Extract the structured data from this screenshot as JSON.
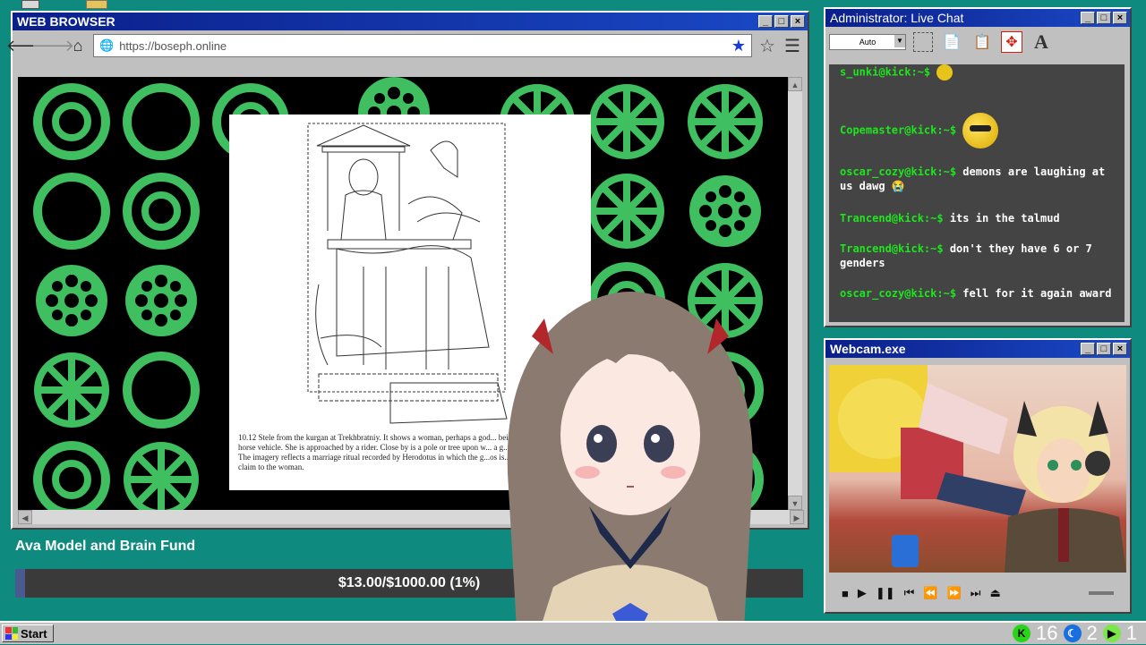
{
  "browser": {
    "title": "WEB BROWSER",
    "url": "https://boseph.online",
    "caption": "10.12 Stele from the kurgan at Trekhbratniy. It shows a woman, perhaps a god... bei... four-horse vehicle. She is approached by a rider. Close by is a pole or tree upon w... a g... ing. The imagery reflects a marriage ritual recorded by Herodotus in which the g...os is... man's claim to the woman."
  },
  "fund": {
    "title": "Ava Model and Brain Fund",
    "amount_text": "$13.00/$1000.00 (1%)",
    "progress": 0.013
  },
  "chat": {
    "title": "Administrator: Live Chat",
    "zoom": "Auto",
    "messages": [
      {
        "user": "s_unki@kick:~$",
        "text": "",
        "emote": "small"
      },
      {
        "user": "Copemaster@kick:~$",
        "text": "",
        "emote": "big"
      },
      {
        "user": "oscar_cozy@kick:~$",
        "text": "demons are laughing at us dawg 😭",
        "emote": ""
      },
      {
        "user": "Trancend@kick:~$",
        "text": "its in the talmud",
        "emote": ""
      },
      {
        "user": "Trancend@kick:~$",
        "text": "don't they have 6 or 7 genders",
        "emote": ""
      },
      {
        "user": "oscar_cozy@kick:~$",
        "text": "fell for it again award",
        "emote": ""
      }
    ]
  },
  "webcam": {
    "title": "Webcam.exe"
  },
  "taskbar": {
    "start_label": "Start",
    "tray": [
      {
        "icon": "kick-icon",
        "value": "16",
        "color": "#29d41a"
      },
      {
        "icon": "moon-icon",
        "value": "2",
        "color": "#1a6fe0"
      },
      {
        "icon": "play-icon",
        "value": "1",
        "color": "#7ae64a"
      }
    ]
  },
  "colors": {
    "desktop": "#0e8a7e",
    "title_bar": "#0b1f8a",
    "chat_user": "#1de61d",
    "pattern_green": "#3fbf5f"
  }
}
